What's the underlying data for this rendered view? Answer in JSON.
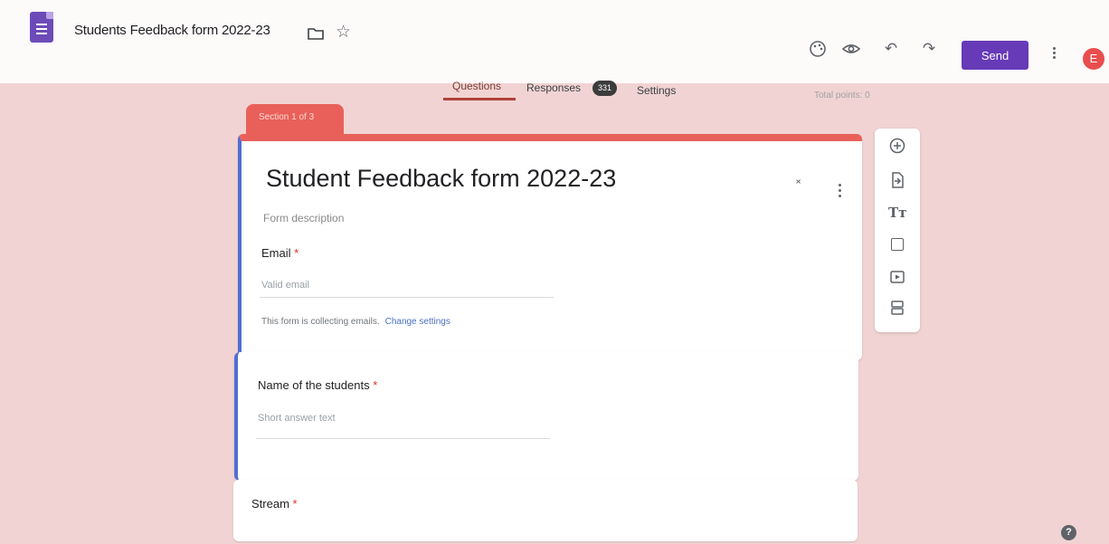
{
  "header": {
    "doc_title": "Students Feedback form 2022-23",
    "send_label": "Send",
    "avatar_initial": "E",
    "icons": [
      "forms-logo-icon",
      "folder-icon",
      "star-icon",
      "palette-icon",
      "preview-eye-icon",
      "undo-icon",
      "redo-icon",
      "more-vert-icon"
    ]
  },
  "tabs": [
    {
      "label": "Questions",
      "active": true
    },
    {
      "label": "Responses",
      "badge": "331"
    },
    {
      "label": "Settings"
    }
  ],
  "total_points": "Total points: 0",
  "section": {
    "label": "Section 1 of 3"
  },
  "form": {
    "title": "Student Feedback form 2022-23",
    "description_placeholder": "Form description",
    "email_label": "Email",
    "email_required": "*",
    "email_placeholder": "Valid email",
    "collecting_text": "This form is collecting emails.",
    "change_settings": "Change settings"
  },
  "questions": [
    {
      "label": "Name of the students",
      "required": "*",
      "placeholder": "Short answer text"
    },
    {
      "label": "Stream",
      "required": "*"
    }
  ],
  "side_toolbar": {
    "icons": [
      "add-question-icon",
      "import-questions-icon",
      "add-title-icon",
      "add-image-icon",
      "add-video-icon",
      "add-section-icon"
    ],
    "title_glyph": "Tт"
  },
  "help": "?",
  "colors": {
    "background": "#f1d3d3",
    "accent": "#673ab7",
    "section": "#e9605a",
    "focus_bar": "#4f6fd3"
  }
}
